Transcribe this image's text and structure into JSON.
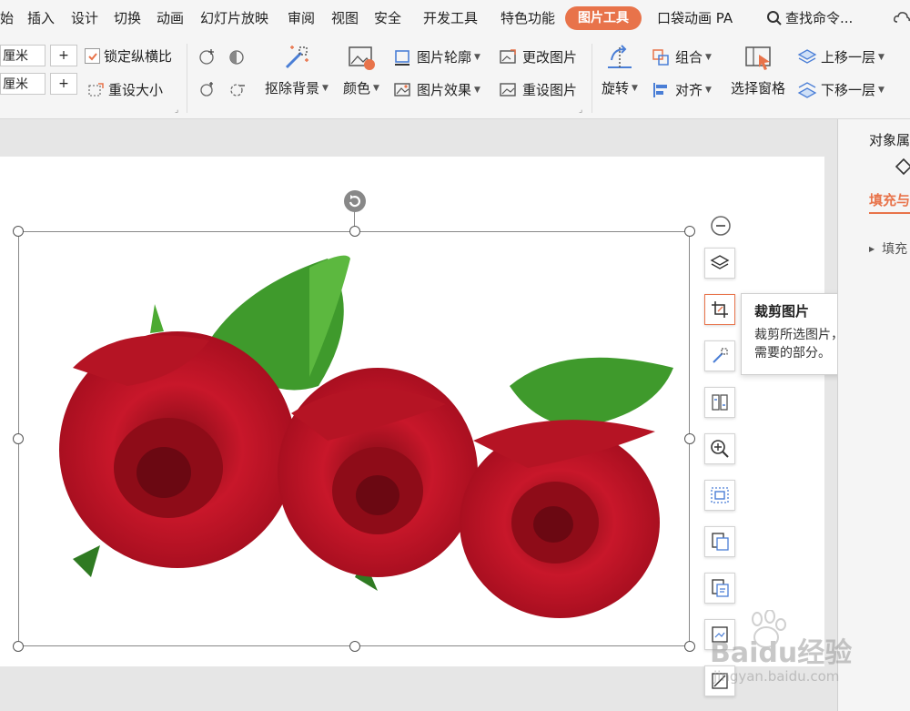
{
  "menu": {
    "tabs": [
      "始",
      "插入",
      "设计",
      "切换",
      "动画",
      "幻灯片放映",
      "审阅",
      "视图",
      "安全",
      "开发工具",
      "特色功能",
      "图片工具",
      "口袋动画 PA"
    ],
    "active_tab": "图片工具",
    "search_label": "查找命令..."
  },
  "ribbon": {
    "height_value": "厘米",
    "width_value": "厘米",
    "spin_plus": "+",
    "lock_ratio_label": "锁定纵横比",
    "reset_size_label": "重设大小",
    "remove_bg_label": "抠除背景",
    "color_label": "颜色",
    "outline_label": "图片轮廓",
    "effect_label": "图片效果",
    "change_pic_label": "更改图片",
    "reset_pic_label": "重设图片",
    "rotate_label": "旋转",
    "group_label": "组合",
    "align_label": "对齐",
    "select_pane_label": "选择窗格",
    "bring_forward_label": "上移一层",
    "send_backward_label": "下移一层"
  },
  "right_panel": {
    "title": "对象属",
    "tab_label": "填充与",
    "section_label": "填充"
  },
  "tooltip": {
    "title": "裁剪图片",
    "line1": "裁剪所选图片，删除不",
    "line2": "需要的部分。"
  },
  "watermark": {
    "brand": "Baidu经验",
    "url": "jingyan.baidu.com"
  },
  "colors": {
    "accent": "#e8734a",
    "rose": "#c8172a",
    "leaf": "#3f9a2c"
  }
}
